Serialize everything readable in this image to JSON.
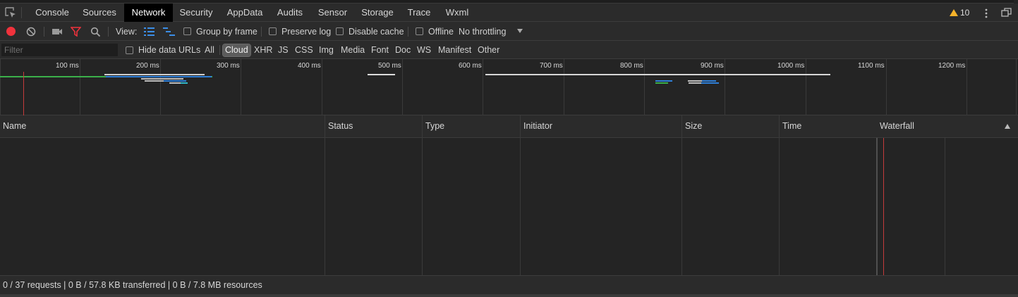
{
  "tabs": [
    {
      "label": "Console",
      "active": false
    },
    {
      "label": "Sources",
      "active": false
    },
    {
      "label": "Network",
      "active": true
    },
    {
      "label": "Security",
      "active": false
    },
    {
      "label": "AppData",
      "active": false
    },
    {
      "label": "Audits",
      "active": false
    },
    {
      "label": "Sensor",
      "active": false
    },
    {
      "label": "Storage",
      "active": false
    },
    {
      "label": "Trace",
      "active": false
    },
    {
      "label": "Wxml",
      "active": false
    }
  ],
  "warnings": {
    "count": "10",
    "icon": "warning-icon",
    "color": "#f5b22a"
  },
  "toolbar": {
    "view_label": "View:",
    "group_by_frame": "Group by frame",
    "preserve_log": "Preserve log",
    "disable_cache": "Disable cache",
    "offline": "Offline",
    "throttling": "No throttling",
    "record_color": "#f0323c"
  },
  "filterbar": {
    "placeholder": "Filter",
    "hide_data_urls": "Hide data URLs",
    "types": [
      "All",
      "Cloud",
      "XHR",
      "JS",
      "CSS",
      "Img",
      "Media",
      "Font",
      "Doc",
      "WS",
      "Manifest",
      "Other"
    ],
    "active_type": "Cloud"
  },
  "overview": {
    "ticks": [
      "100 ms",
      "200 ms",
      "300 ms",
      "400 ms",
      "500 ms",
      "600 ms",
      "700 ms",
      "800 ms",
      "900 ms",
      "1000 ms",
      "1100 ms",
      "1200 ms"
    ],
    "marker_color": "#c43b3b"
  },
  "table": {
    "columns": [
      "Name",
      "Status",
      "Type",
      "Initiator",
      "Size",
      "Time",
      "Waterfall"
    ],
    "rows": []
  },
  "status": {
    "text": "0 / 37 requests | 0 B / 57.8 KB transferred | 0 B / 7.8 MB resources"
  }
}
